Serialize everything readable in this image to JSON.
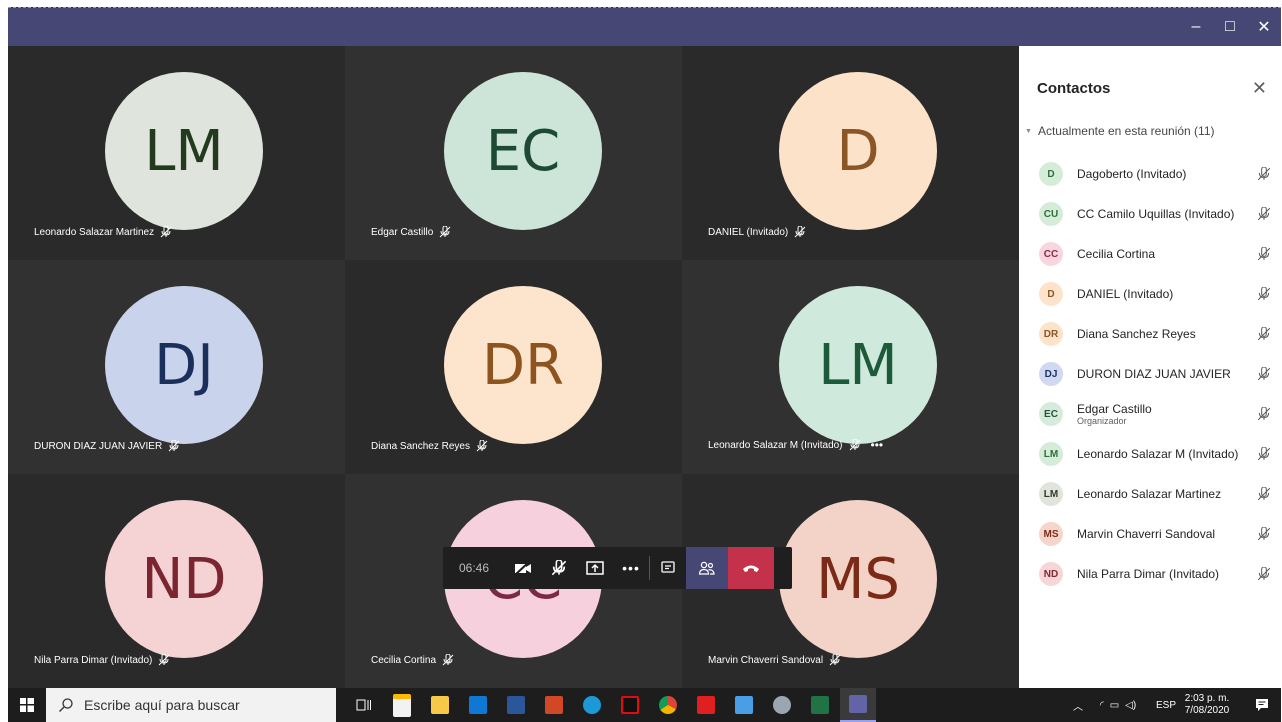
{
  "window": {
    "minimize_label": "–",
    "maximize_label": "□",
    "close_label": "✕"
  },
  "tiles": [
    {
      "initials": "LM",
      "name": "Leonardo Salazar Martinez",
      "bg": "#dfe4dc",
      "fg": "#243a1f"
    },
    {
      "initials": "EC",
      "name": "Edgar Castillo",
      "bg": "#cde4d9",
      "fg": "#1c4a33"
    },
    {
      "initials": "D",
      "name": "DANIEL (Invitado)",
      "bg": "#fbe2c9",
      "fg": "#8a5626"
    },
    {
      "initials": "DJ",
      "name": "DURON DIAZ JUAN JAVIER",
      "bg": "#c9d4ec",
      "fg": "#1b2f5c"
    },
    {
      "initials": "DR",
      "name": "Diana Sanchez Reyes",
      "bg": "#fde4cd",
      "fg": "#8e5420"
    },
    {
      "initials": "LM",
      "name": "Leonardo Salazar M (Invitado)",
      "bg": "#cfe9dc",
      "fg": "#1d5a3a"
    },
    {
      "initials": "ND",
      "name": "Nila Parra Dimar (Invitado)",
      "bg": "#f5d3d5",
      "fg": "#7b2530"
    },
    {
      "initials": "CC",
      "name": "Cecilia Cortina",
      "bg": "#f6d1dd",
      "fg": "#7d2845"
    },
    {
      "initials": "MS",
      "name": "Marvin Chaverri Sandoval",
      "bg": "#f3d2c8",
      "fg": "#7a2a16"
    }
  ],
  "panel": {
    "title": "Contactos",
    "close_label": "✕",
    "section": "Actualmente en esta reunión (11)",
    "people": [
      {
        "initials": "D",
        "name": "Dagoberto (Invitado)",
        "role": "",
        "bg": "#d5ecd9",
        "fg": "#2f6e3d"
      },
      {
        "initials": "CU",
        "name": "CC Camilo Uquillas (Invitado)",
        "role": "",
        "bg": "#d5ecd9",
        "fg": "#2f6e3d"
      },
      {
        "initials": "CC",
        "name": "Cecilia Cortina",
        "role": "",
        "bg": "#f7d6df",
        "fg": "#8a2a47"
      },
      {
        "initials": "D",
        "name": "DANIEL (Invitado)",
        "role": "",
        "bg": "#fde3c9",
        "fg": "#8b5624"
      },
      {
        "initials": "DR",
        "name": "Diana Sanchez Reyes",
        "role": "",
        "bg": "#fde3c9",
        "fg": "#8b5624"
      },
      {
        "initials": "DJ",
        "name": "DURON DIAZ JUAN JAVIER",
        "role": "",
        "bg": "#d0d9ef",
        "fg": "#1f3463"
      },
      {
        "initials": "EC",
        "name": "Edgar Castillo",
        "role": "Organizador",
        "bg": "#d7ebdd",
        "fg": "#24553a"
      },
      {
        "initials": "LM",
        "name": "Leonardo Salazar M (Invitado)",
        "role": "",
        "bg": "#d5ecd9",
        "fg": "#2f6e3d"
      },
      {
        "initials": "LM",
        "name": "Leonardo Salazar Martinez",
        "role": "",
        "bg": "#e0e4dd",
        "fg": "#2e3d2a"
      },
      {
        "initials": "MS",
        "name": "Marvin Chaverri Sandoval",
        "role": "",
        "bg": "#f6d5cb",
        "fg": "#7d2c18"
      },
      {
        "initials": "ND",
        "name": "Nila Parra Dimar (Invitado)",
        "role": "",
        "bg": "#f7d6d8",
        "fg": "#7f2733"
      }
    ]
  },
  "controls": {
    "timer": "06:46"
  },
  "taskbar": {
    "search_placeholder": "Escribe aquí para buscar",
    "lang": "ESP",
    "time": "2:03 p. m.",
    "date": "7/08/2020"
  },
  "colors": {
    "teams_purple": "#464775",
    "hangup_red": "#c4314b",
    "tile_bg": "#2d2c2c",
    "tile_bg_alt": "#323131"
  }
}
